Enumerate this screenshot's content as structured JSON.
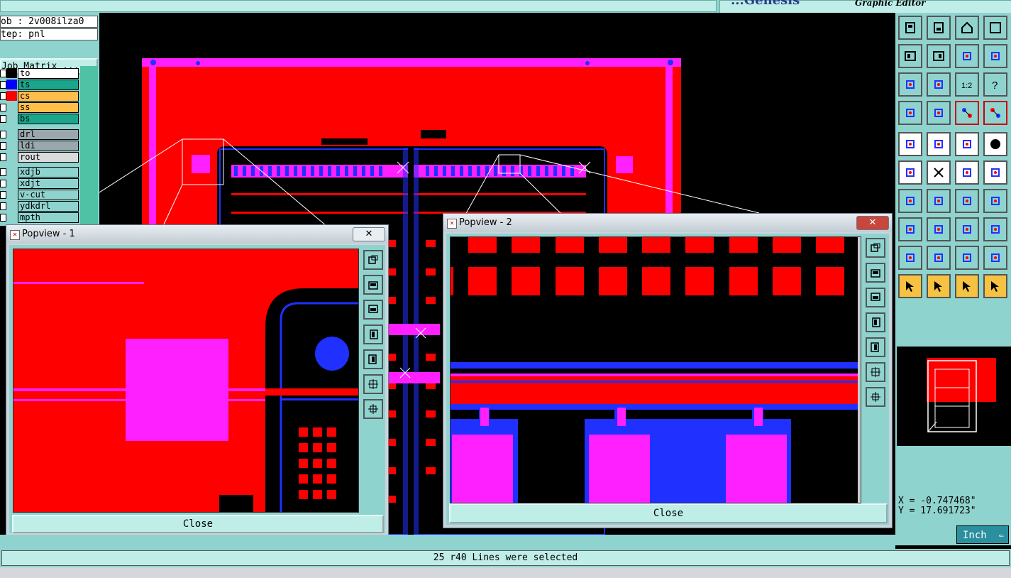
{
  "app": {
    "subtitle": "Graphic Editor",
    "logo_text": "...Genesis"
  },
  "job": {
    "job_field": "ob : 2v008ilza0",
    "step_field": "tep: pnl",
    "matrix_button": "Job Matrix ..."
  },
  "layers": [
    {
      "name": "to",
      "color": "#ffffff",
      "swatch": "#000000"
    },
    {
      "name": "ts",
      "color": "#1ba58b",
      "swatch": "#0000ff"
    },
    {
      "name": "cs",
      "color": "#ffbd4a",
      "swatch": "#ff0000"
    },
    {
      "name": "ss",
      "color": "#ffbd4a",
      "swatch": "#8fd3cf"
    },
    {
      "name": "bs",
      "color": "#1ba58b",
      "swatch": "#8fd3cf"
    },
    {
      "name": "drl",
      "color": "#9aa7ad",
      "swatch": "#8fd3cf"
    },
    {
      "name": "ldi",
      "color": "#9aa7ad",
      "swatch": "#8fd3cf"
    },
    {
      "name": "rout",
      "color": "#d8dadb",
      "swatch": "#8fd3cf"
    },
    {
      "name": "xdjb",
      "color": "#8fd3cf",
      "swatch": "#8fd3cf"
    },
    {
      "name": "xdjt",
      "color": "#8fd3cf",
      "swatch": "#8fd3cf"
    },
    {
      "name": "v-cut",
      "color": "#8fd3cf",
      "swatch": "#8fd3cf"
    },
    {
      "name": "ydkdrl",
      "color": "#8fd3cf",
      "swatch": "#8fd3cf"
    },
    {
      "name": "mpth",
      "color": "#8fd3cf",
      "swatch": "#8fd3cf"
    }
  ],
  "popview1": {
    "title": "Popview - 1",
    "close_label": "Close",
    "close_x": "✕"
  },
  "popview2": {
    "title": "Popview - 2",
    "close_label": "Close",
    "close_x": "✕"
  },
  "coords": {
    "x": "X = -0.747468\"",
    "y": "Y = 17.691723\""
  },
  "units": {
    "label": "Inch"
  },
  "status": {
    "message": "25 r40 Lines were selected"
  },
  "tools": [
    "panel-top-icon",
    "panel-bottom-icon",
    "home-icon",
    "window-icon",
    "panel-left-icon",
    "panel-right-icon",
    "undo-view-icon",
    "redraw-icon",
    "zoom-fit-icon",
    "zoom-center-icon",
    "scale-1-2-icon",
    "help-icon",
    "settings-icon",
    "grid-icon",
    "snap-red-icon",
    "snap-red2-icon",
    "add-pad-icon",
    "draw-line-icon",
    "ruler-icon",
    "circle-pad-icon",
    "connect-icon",
    "delete-icon",
    "move-point-icon",
    "measure-icon",
    "angle-icon",
    "line-icon",
    "rotate-icon",
    "flip-icon",
    "pad-select-icon",
    "minus-icon",
    "resize-icon",
    "copy-icon",
    "triangle-icon",
    "arc-icon",
    "text-a-icon",
    "text-b-icon",
    "select-arrow-icon",
    "select-box-icon",
    "select-poly-icon",
    "select-net-icon"
  ],
  "colors": {
    "panel": "#8fd3cf",
    "copper": "#ff0000",
    "mask": "#ff20ff",
    "blue": "#2030ff"
  }
}
